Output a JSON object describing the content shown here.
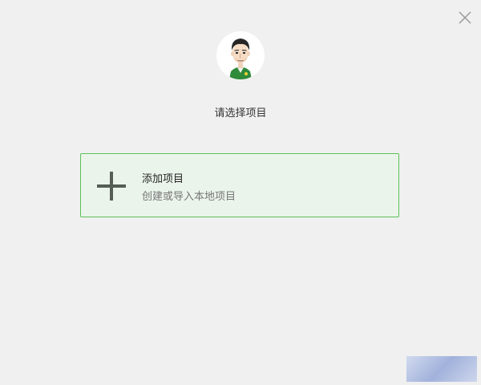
{
  "window": {
    "close_icon": "close-icon"
  },
  "avatar": {
    "icon": "user-avatar-cartoon"
  },
  "title": "请选择项目",
  "add_project": {
    "icon": "plus-icon",
    "title": "添加项目",
    "subtitle": "创建或导入本地项目"
  },
  "colors": {
    "background": "#f0f0f0",
    "card_background": "#ebf4eb",
    "card_border": "#5cc25b",
    "plus_icon": "#555d55"
  }
}
